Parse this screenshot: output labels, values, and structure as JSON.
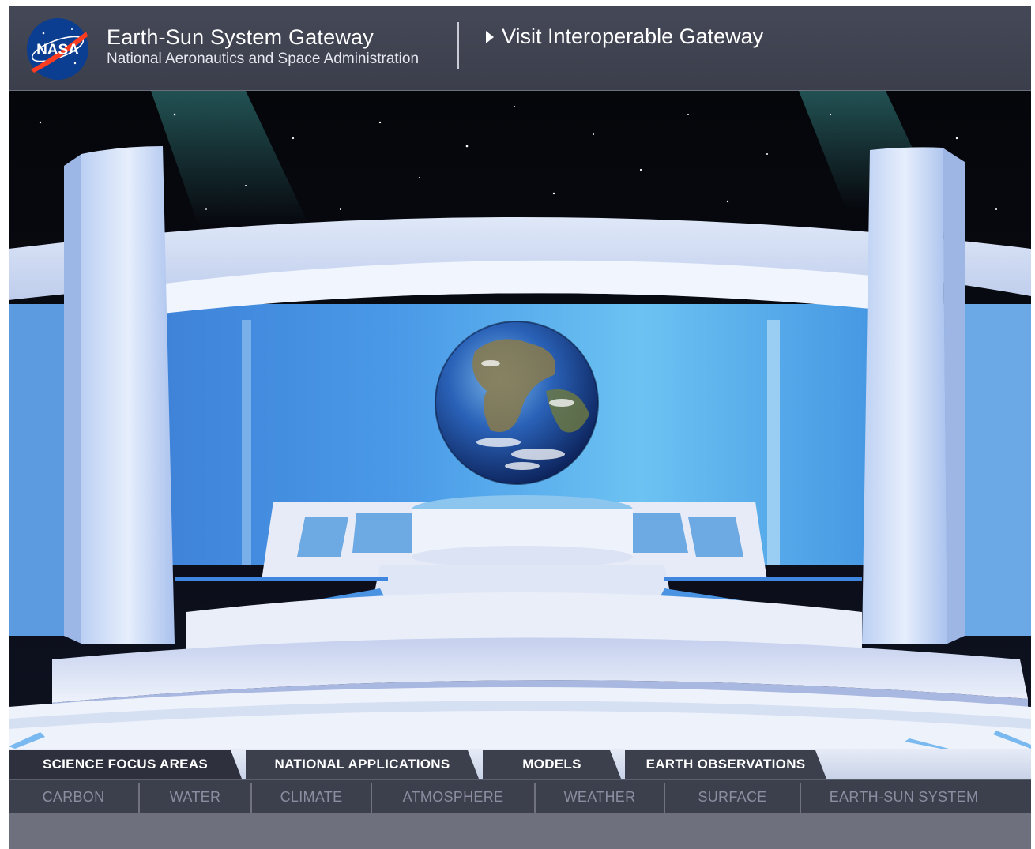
{
  "header": {
    "logo_text": "NASA",
    "title": "Earth-Sun System Gateway",
    "subtitle": "National Aeronautics and Space Administration",
    "visit_link": "Visit Interoperable Gateway"
  },
  "tabs": [
    {
      "label": "SCIENCE FOCUS AREAS",
      "active": true
    },
    {
      "label": "NATIONAL APPLICATIONS",
      "active": false
    },
    {
      "label": "MODELS",
      "active": false
    },
    {
      "label": "EARTH OBSERVATIONS",
      "active": false
    }
  ],
  "subnav": [
    {
      "label": "CARBON"
    },
    {
      "label": "WATER"
    },
    {
      "label": "CLIMATE"
    },
    {
      "label": "ATMOSPHERE"
    },
    {
      "label": "WEATHER"
    },
    {
      "label": "SURFACE"
    },
    {
      "label": "EARTH-SUN SYSTEM"
    }
  ],
  "colors": {
    "header_bg": "#3b3e4b",
    "nav_bg": "#3c3f4c",
    "active_tab": "#2e313d",
    "subnav_text": "#8a8ea0",
    "sky": "#05060c",
    "wall_blue": "#5aa6e8"
  }
}
